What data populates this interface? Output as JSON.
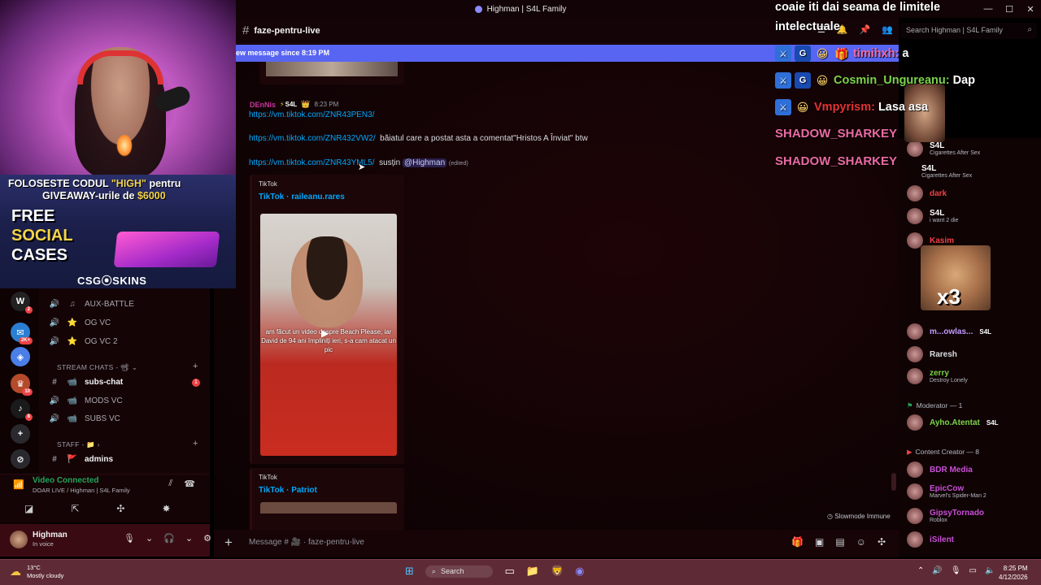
{
  "window": {
    "title": "Highman | S4L Family",
    "controls": [
      "—",
      "☐",
      "✕"
    ]
  },
  "header": {
    "channel_name": "faze-pentru-live",
    "search_placeholder": "Search Highman | S4L Family",
    "new_message_banner": "ew message since 8:19 PM"
  },
  "message": {
    "author": "DEnNis",
    "author_tag": "S4L",
    "time": "8:23 PM",
    "lines": [
      {
        "link": "https://vm.tiktok.com/ZNR43PEN3/",
        "text": ""
      },
      {
        "link": "https://vm.tiktok.com/ZNR432VW2/",
        "text": "băiatul care a postat asta a comentat\"Hristos A Înviat\"  btw"
      },
      {
        "link": "https://vm.tiktok.com/ZNR43YML5/",
        "text": "susțin",
        "mention": "@Highman",
        "edited": "(edited)"
      }
    ],
    "embeds": [
      {
        "provider": "TikTok",
        "title": "TikTok · raileanu.rares",
        "caption": "am făcut un video despre Beach Please, iar David de 94 ani împliniți ieri, s-a cam atacat un pic"
      },
      {
        "provider": "TikTok",
        "title": "TikTok · Patriot"
      }
    ],
    "slowmode": "Slowmode Immune"
  },
  "composer": {
    "placeholder": "Message # 🎥 · faze-pentru-live"
  },
  "channels": {
    "items": [
      {
        "label": "AUX-BATTLE",
        "icon": "voice-icon"
      },
      {
        "label": "OG VC",
        "icon": "voice-icon"
      },
      {
        "label": "OG VC 2",
        "icon": "voice-icon"
      }
    ],
    "stream_category": "STREAM CHATS - 📽",
    "stream_items": [
      {
        "label": "subs-chat",
        "unread": "1"
      },
      {
        "label": "MODS VC"
      },
      {
        "label": "SUBS VC"
      }
    ],
    "staff_category": "STAFF - 📁",
    "staff_items": [
      {
        "label": "admins"
      }
    ]
  },
  "voice": {
    "status": "Video Connected",
    "server": "DOAR LIVE / Highman | S4L Family"
  },
  "user": {
    "name": "Highman",
    "status": "In voice"
  },
  "servers": {
    "badges": [
      "2",
      "2K+",
      "10",
      "8"
    ]
  },
  "ad": {
    "line1_a": "FOLOSESTE CODUL ",
    "line1_code": "\"HIGH\"",
    "line1_b": " pentru",
    "line2_a": "GIVEAWAY-urile de ",
    "line2_amount": "$6000",
    "big1": "FREE",
    "big2": "SOCIAL",
    "big3": "CASES",
    "brand": "CSG⦿SKINS"
  },
  "stream_chat": {
    "top_message_1": "coaie iti dai seama de limitele",
    "top_message_2": "intelectuale",
    "lines": [
      {
        "user": "timihxh:",
        "message": "a",
        "color": "#f06aa5"
      },
      {
        "user": "Cosmin_Ungureanu:",
        "message": "Dap",
        "color": "#7bd34a"
      },
      {
        "user": "Vmpyrism:",
        "message": "Lasa asa",
        "color": "#e23434"
      }
    ],
    "spam_1": "SHADOW_SHARKEY",
    "spam_2": "SHADOW_SHARKEY"
  },
  "members": {
    "online": [
      {
        "name": "dark",
        "color": "#ed4245"
      },
      {
        "name": "Kasim",
        "color": "#ed4245"
      },
      {
        "name": "Raresh",
        "color": "#dbdee1"
      },
      {
        "name": "zerry",
        "color": "#7bd34a",
        "status": "Destroy Lonely"
      },
      {
        "name": "m...owlas...",
        "color": "#c29bff",
        "tag": "S4L"
      }
    ],
    "partial": [
      {
        "status": "Cigarettes After Sex",
        "tag": "S4L"
      },
      {
        "status": "i want 2 die",
        "tag": "S4L"
      }
    ],
    "moderator_header": "Moderator — 1",
    "moderator": {
      "name": "Ayho.Atentat",
      "tag": "S4L"
    },
    "creator_header": "Content Creator — 8",
    "creators": [
      {
        "name": "BDR Media",
        "color": "#c94fd8"
      },
      {
        "name": "EpicCow",
        "color": "#c94fd8",
        "status": "Marvel's Spider-Man 2"
      },
      {
        "name": "GipsyTornado",
        "color": "#c94fd8",
        "status": "Roblox"
      },
      {
        "name": "iSilent",
        "color": "#c94fd8"
      }
    ],
    "meme_text": "x3"
  },
  "taskbar": {
    "weather_temp": "13°C",
    "weather_desc": "Mostly cloudy",
    "search": "Search",
    "time": "8:25 PM",
    "date": "4/12/2026"
  }
}
